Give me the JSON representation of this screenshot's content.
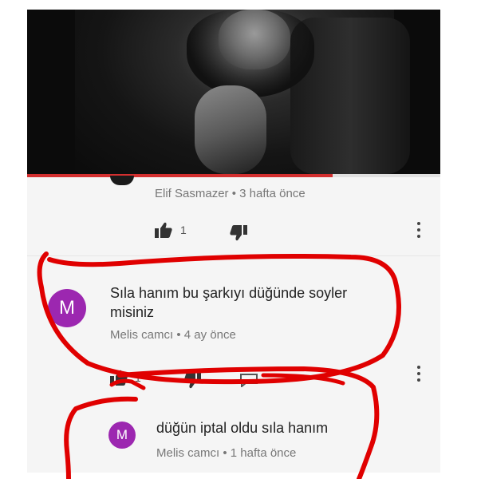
{
  "video": {
    "progress": 0.74
  },
  "comments": [
    {
      "author": "Elif Sasmazer",
      "sep": "•",
      "time": "3 hafta önce",
      "likes": "1"
    },
    {
      "avatar_letter": "M",
      "text": "Sıla hanım bu şarkıyı düğünde soyler misiniz",
      "author": "Melis camcı",
      "sep": "•",
      "time": "4 ay önce",
      "likes": "1"
    },
    {
      "avatar_letter": "M",
      "text": "düğün iptal oldu sıla hanım",
      "author": "Melis camcı",
      "sep": "•",
      "time": "1 hafta önce"
    }
  ],
  "colors": {
    "avatar": "#9c27b0",
    "progress": "#d32f2f",
    "scribble": "#e00000"
  },
  "icons": [
    "thumbs-up-icon",
    "thumbs-down-icon",
    "more-vert-icon"
  ]
}
